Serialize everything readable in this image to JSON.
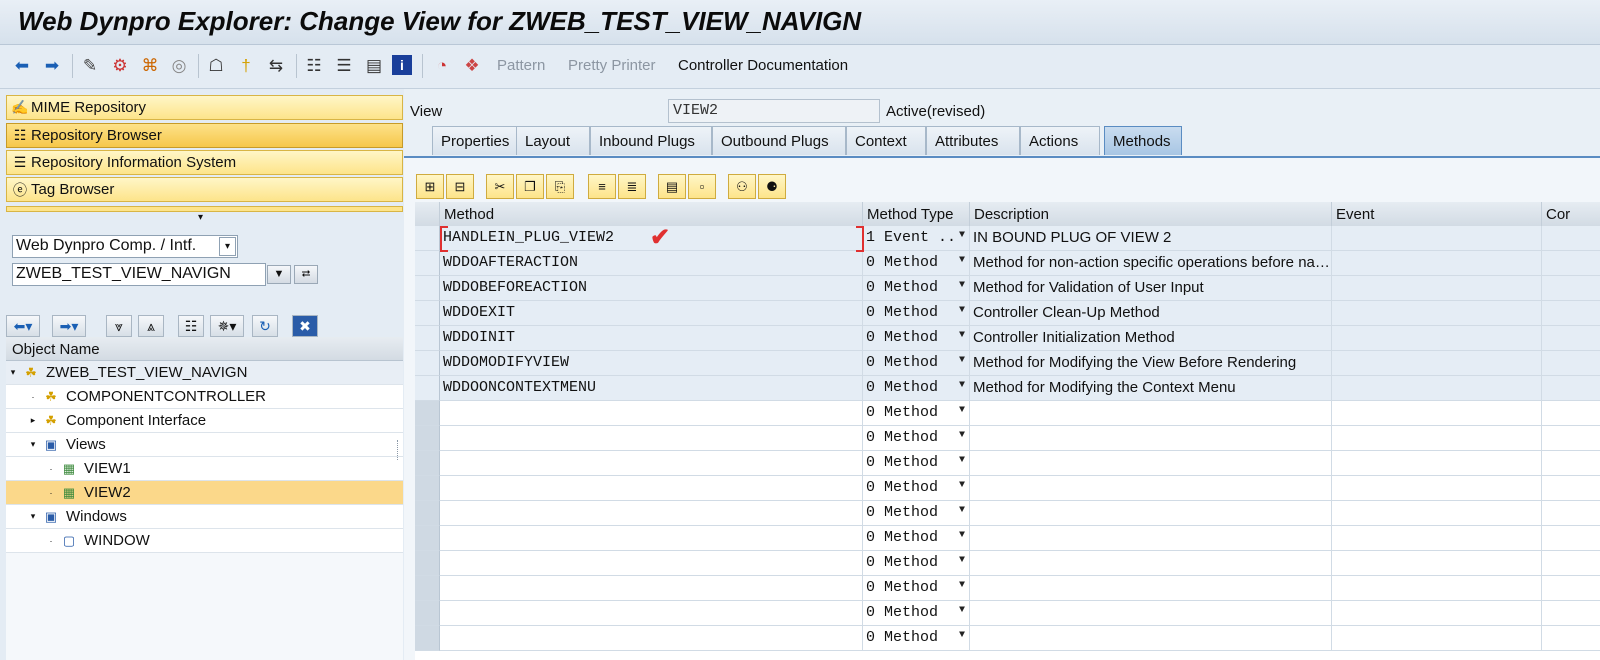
{
  "title": "Web Dynpro Explorer: Change View for ZWEB_TEST_VIEW_NAVIGN",
  "toolbar": {
    "pattern": "Pattern",
    "pretty_printer": "Pretty Printer",
    "controller_documentation": "Controller Documentation"
  },
  "nav": {
    "mime_repository": "MIME Repository",
    "repository_browser": "Repository Browser",
    "repository_information_system": "Repository Information System",
    "tag_browser": "Tag Browser"
  },
  "object_type": "Web Dynpro Comp. / Intf.",
  "object_name_value": "ZWEB_TEST_VIEW_NAVIGN",
  "tree": {
    "header": "Object Name",
    "nodes": [
      {
        "label": "ZWEB_TEST_VIEW_NAVIGN",
        "icon": "component-icon"
      },
      {
        "label": "COMPONENTCONTROLLER",
        "icon": "controller-icon"
      },
      {
        "label": "Component Interface",
        "icon": "interface-icon"
      },
      {
        "label": "Views",
        "icon": "folder-icon"
      },
      {
        "label": "VIEW1",
        "icon": "view-icon"
      },
      {
        "label": "VIEW2",
        "icon": "view-icon"
      },
      {
        "label": "Windows",
        "icon": "folder-icon"
      },
      {
        "label": "WINDOW",
        "icon": "window-icon"
      }
    ]
  },
  "view": {
    "label": "View",
    "name": "VIEW2",
    "status": "Active(revised)"
  },
  "tabs": [
    "Properties",
    "Layout",
    "Inbound Plugs",
    "Outbound Plugs",
    "Context",
    "Attributes",
    "Actions",
    "Methods"
  ],
  "active_tab": "Methods",
  "grid": {
    "columns": [
      "Method",
      "Method Type",
      "Description",
      "Event",
      "Cor"
    ],
    "rows": [
      {
        "method": "HANDLEIN_PLUG_VIEW2",
        "type": "1 Event ..",
        "description": "IN BOUND PLUG OF VIEW 2"
      },
      {
        "method": "WDDOAFTERACTION",
        "type": "0 Method",
        "description": "Method for non-action specific operations before na…"
      },
      {
        "method": "WDDOBEFOREACTION",
        "type": "0 Method",
        "description": "Method for Validation of User Input"
      },
      {
        "method": "WDDOEXIT",
        "type": "0 Method",
        "description": "Controller Clean-Up Method"
      },
      {
        "method": "WDDOINIT",
        "type": "0 Method",
        "description": "Controller Initialization Method"
      },
      {
        "method": "WDDOMODIFYVIEW",
        "type": "0 Method",
        "description": "Method for Modifying the View Before Rendering"
      },
      {
        "method": "WDDOONCONTEXTMENU",
        "type": "0 Method",
        "description": "Method for Modifying the Context Menu"
      },
      {
        "method": "",
        "type": "0 Method",
        "description": ""
      },
      {
        "method": "",
        "type": "0 Method",
        "description": ""
      },
      {
        "method": "",
        "type": "0 Method",
        "description": ""
      },
      {
        "method": "",
        "type": "0 Method",
        "description": ""
      },
      {
        "method": "",
        "type": "0 Method",
        "description": ""
      },
      {
        "method": "",
        "type": "0 Method",
        "description": ""
      },
      {
        "method": "",
        "type": "0 Method",
        "description": ""
      },
      {
        "method": "",
        "type": "0 Method",
        "description": ""
      },
      {
        "method": "",
        "type": "0 Method",
        "description": ""
      },
      {
        "method": "",
        "type": "0 Method",
        "description": ""
      }
    ]
  },
  "colors": {
    "accent": "#5a8cc2",
    "nav_button": "#fde48a",
    "selection": "#fbd88a",
    "annotation": "#e03030"
  }
}
